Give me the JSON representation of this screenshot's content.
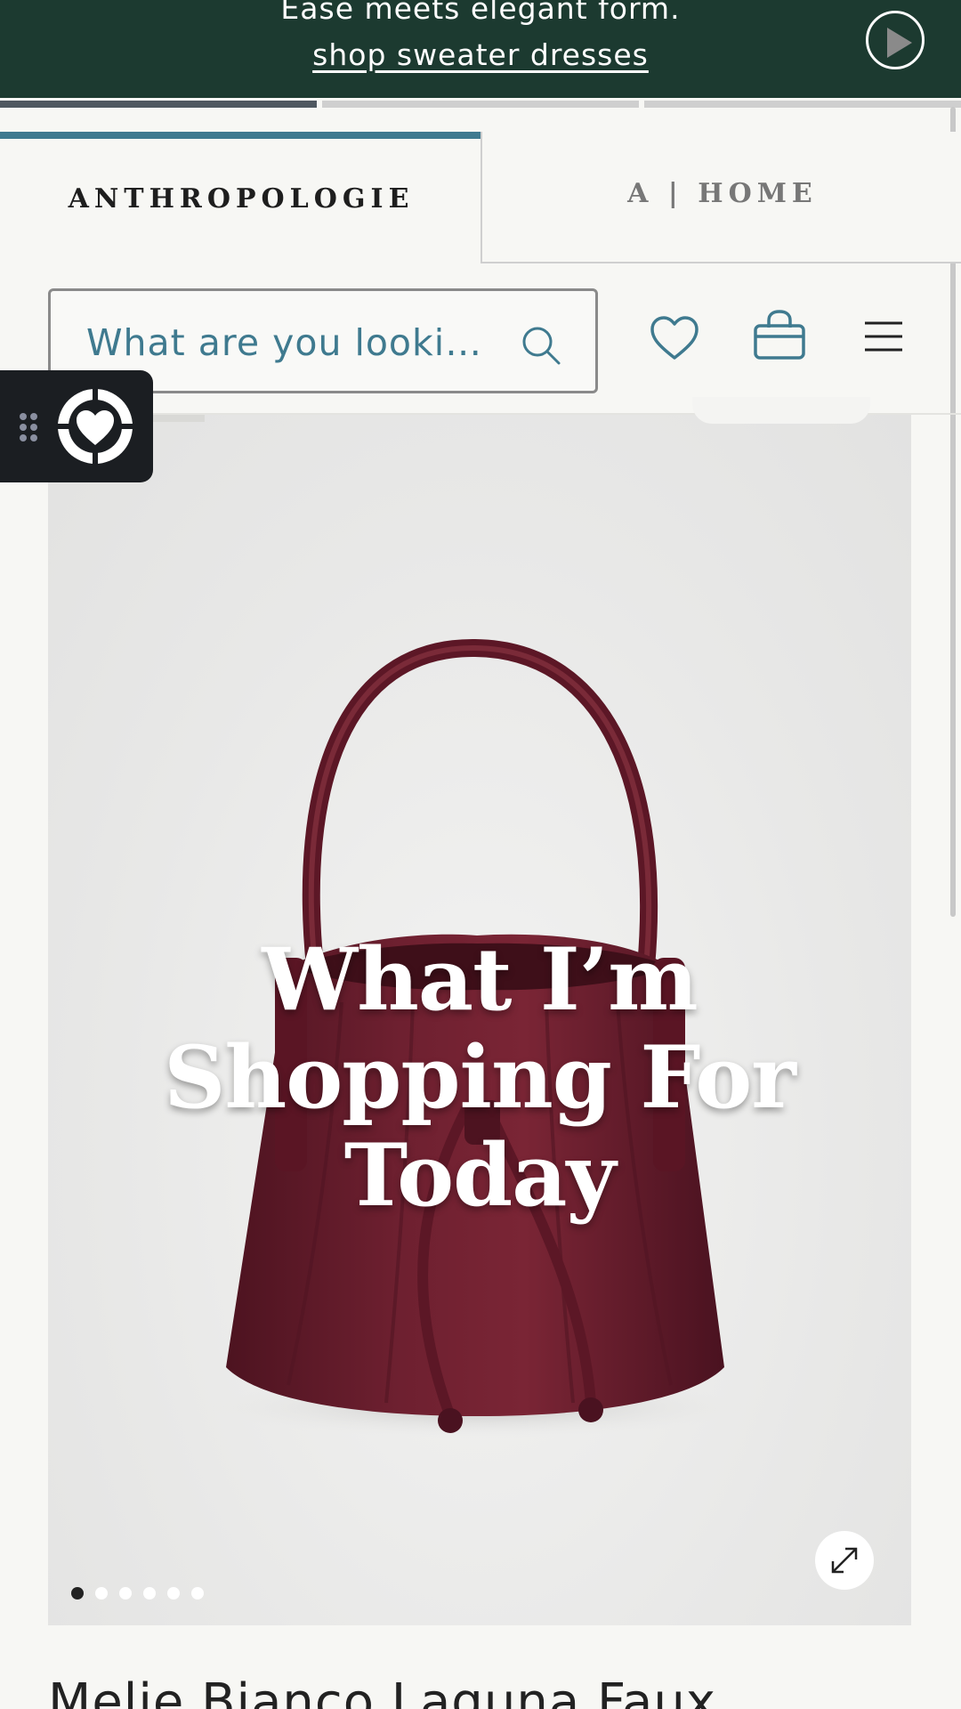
{
  "promo": {
    "headline": "Ease meets elegant form.",
    "link": "shop sweater dresses"
  },
  "story_progress": [
    1.0,
    0.0,
    0.0
  ],
  "brand_tabs": {
    "primary": "ANTHROPOLOGIE",
    "secondary": "A | HOME"
  },
  "search": {
    "placeholder": "What are you looking for?"
  },
  "header_icons": [
    "heart-icon",
    "shopping-bag-icon",
    "hamburger-menu-icon"
  ],
  "product": {
    "overlay_title": "What I’m Shopping For Today",
    "carousel_total": 6,
    "carousel_active": 1,
    "title": "Melie Bianco Laguna Faux"
  },
  "colors": {
    "promo_bg": "#1c3a30",
    "accent_teal": "#3f7a8f",
    "bag": "#6a1e2c"
  }
}
